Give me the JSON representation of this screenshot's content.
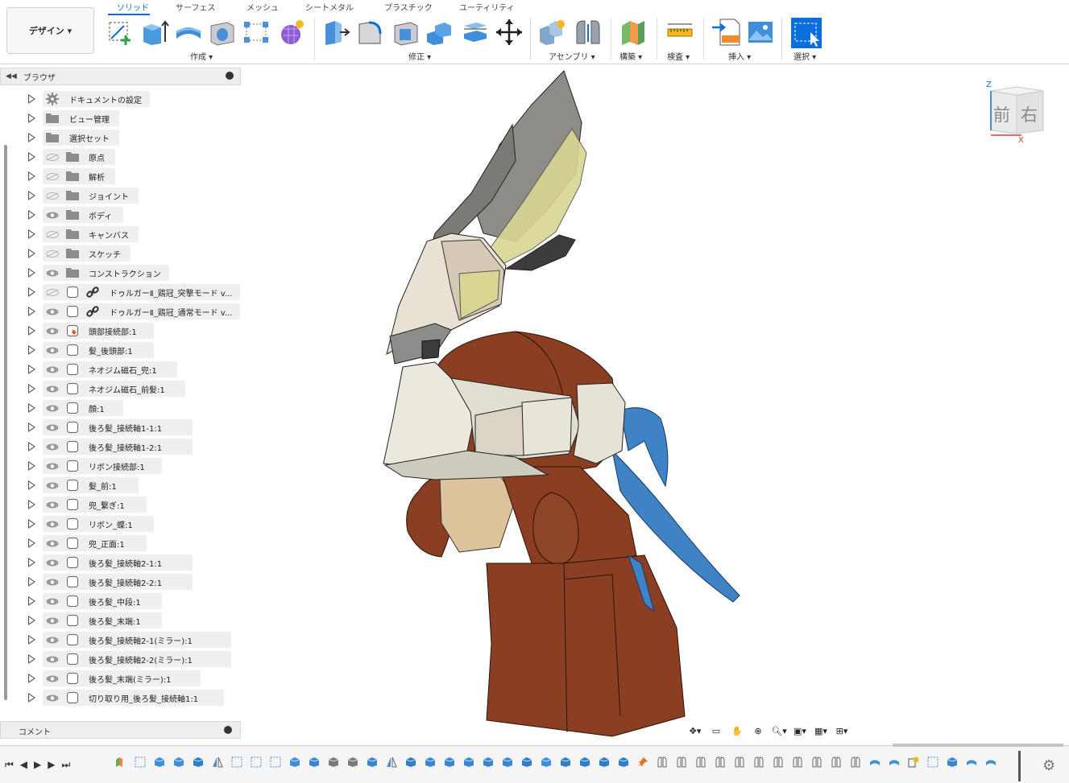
{
  "ribbon": {
    "workspace_button": "デザイン ▾",
    "tabs": [
      "ソリッド",
      "サーフェス",
      "メッシュ",
      "シートメタル",
      "プラスチック",
      "ユーティリティ"
    ],
    "groups": [
      {
        "label": "作成 ▾"
      },
      {
        "label": "修正 ▾"
      },
      {
        "label": "アセンブリ ▾"
      },
      {
        "label": "構築 ▾"
      },
      {
        "label": "検査 ▾"
      },
      {
        "label": "挿入 ▾"
      },
      {
        "label": "選択 ▾"
      }
    ]
  },
  "browser": {
    "title": "ブラウザ",
    "items": [
      {
        "label": "ドキュメントの設定",
        "icon": "gear-icon",
        "eye": "none"
      },
      {
        "label": "ビュー管理",
        "icon": "folder-icon",
        "eye": "none"
      },
      {
        "label": "選択セット",
        "icon": "folder-icon",
        "eye": "none"
      },
      {
        "label": "原点",
        "icon": "folder-icon",
        "eye": "hidden"
      },
      {
        "label": "解析",
        "icon": "folder-icon",
        "eye": "hidden"
      },
      {
        "label": "ジョイント",
        "icon": "folder-icon",
        "eye": "hidden"
      },
      {
        "label": "ボディ",
        "icon": "folder-icon",
        "eye": "visible"
      },
      {
        "label": "キャンバス",
        "icon": "folder-icon",
        "eye": "hidden"
      },
      {
        "label": "スケッチ",
        "icon": "folder-icon",
        "eye": "hidden"
      },
      {
        "label": "コンストラクション",
        "icon": "folder-icon",
        "eye": "visible"
      },
      {
        "label": "ドゥルガーⅡ_鶏冠_突撃モード v...",
        "icon": "link-icon",
        "eye": "hidden"
      },
      {
        "label": "ドゥルガーⅡ_鶏冠_通常モード v...",
        "icon": "link-icon",
        "eye": "visible"
      },
      {
        "label": "頭部接続部:1",
        "icon": "component-active-icon",
        "eye": "visible"
      },
      {
        "label": "髪_後頭部:1",
        "icon": "component-icon",
        "eye": "visible"
      },
      {
        "label": "ネオジム磁石_兜:1",
        "icon": "component-icon",
        "eye": "visible"
      },
      {
        "label": "ネオジム磁石_前髪:1",
        "icon": "component-icon",
        "eye": "visible"
      },
      {
        "label": "顔:1",
        "icon": "component-icon",
        "eye": "visible"
      },
      {
        "label": "後ろ髪_接続軸1-1:1",
        "icon": "component-icon",
        "eye": "visible"
      },
      {
        "label": "後ろ髪_接続軸1-2:1",
        "icon": "component-icon",
        "eye": "visible"
      },
      {
        "label": "リボン接続部:1",
        "icon": "component-icon",
        "eye": "visible"
      },
      {
        "label": "髪_前:1",
        "icon": "component-icon",
        "eye": "visible"
      },
      {
        "label": "兜_繋ぎ:1",
        "icon": "component-icon",
        "eye": "visible"
      },
      {
        "label": "リボン_蝶:1",
        "icon": "component-icon",
        "eye": "visible"
      },
      {
        "label": "兜_正面:1",
        "icon": "component-icon",
        "eye": "visible"
      },
      {
        "label": "後ろ髪_接続軸2-1:1",
        "icon": "component-icon",
        "eye": "visible"
      },
      {
        "label": "後ろ髪_接続軸2-2:1",
        "icon": "component-icon",
        "eye": "visible"
      },
      {
        "label": "後ろ髪_中段:1",
        "icon": "component-icon",
        "eye": "visible"
      },
      {
        "label": "後ろ髪_末端:1",
        "icon": "component-icon",
        "eye": "visible"
      },
      {
        "label": "後ろ髪_接続軸2-1(ミラー):1",
        "icon": "component-icon",
        "eye": "visible"
      },
      {
        "label": "後ろ髪_接続軸2-2(ミラー):1",
        "icon": "component-icon",
        "eye": "visible"
      },
      {
        "label": "後ろ髪_末端(ミラー):1",
        "icon": "component-icon",
        "eye": "visible"
      },
      {
        "label": "切り取り用_後ろ髪_接続軸1:1",
        "icon": "component-icon",
        "eye": "visible"
      }
    ]
  },
  "comments": {
    "title": "コメント"
  },
  "viewcube": {
    "front": "前",
    "right": "右",
    "axis_z": "Z",
    "axis_x": "X"
  },
  "colors": {
    "accent": "#0a6fd8",
    "hair": "#8a3f22",
    "armor": "#e6e2d4",
    "ribbon": "#3f83c4",
    "crest_yellow": "#d8d692"
  }
}
